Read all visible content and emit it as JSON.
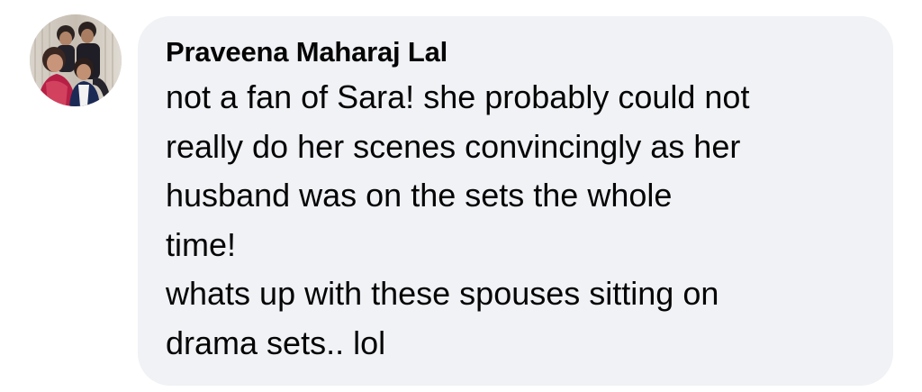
{
  "comment": {
    "author": "Praveena Maharaj Lal",
    "lines": [
      "not a fan of Sara! she probably could not",
      "really do her scenes convincingly as her",
      "husband was on the sets the whole",
      "time!",
      "whats up with these spouses sitting on",
      "drama sets.. lol"
    ]
  },
  "avatar": {
    "icon": "profile-photo",
    "description_colors": {
      "background": "#cfc7bd",
      "bubble": "#f0f2f5",
      "text": "#050505"
    }
  }
}
